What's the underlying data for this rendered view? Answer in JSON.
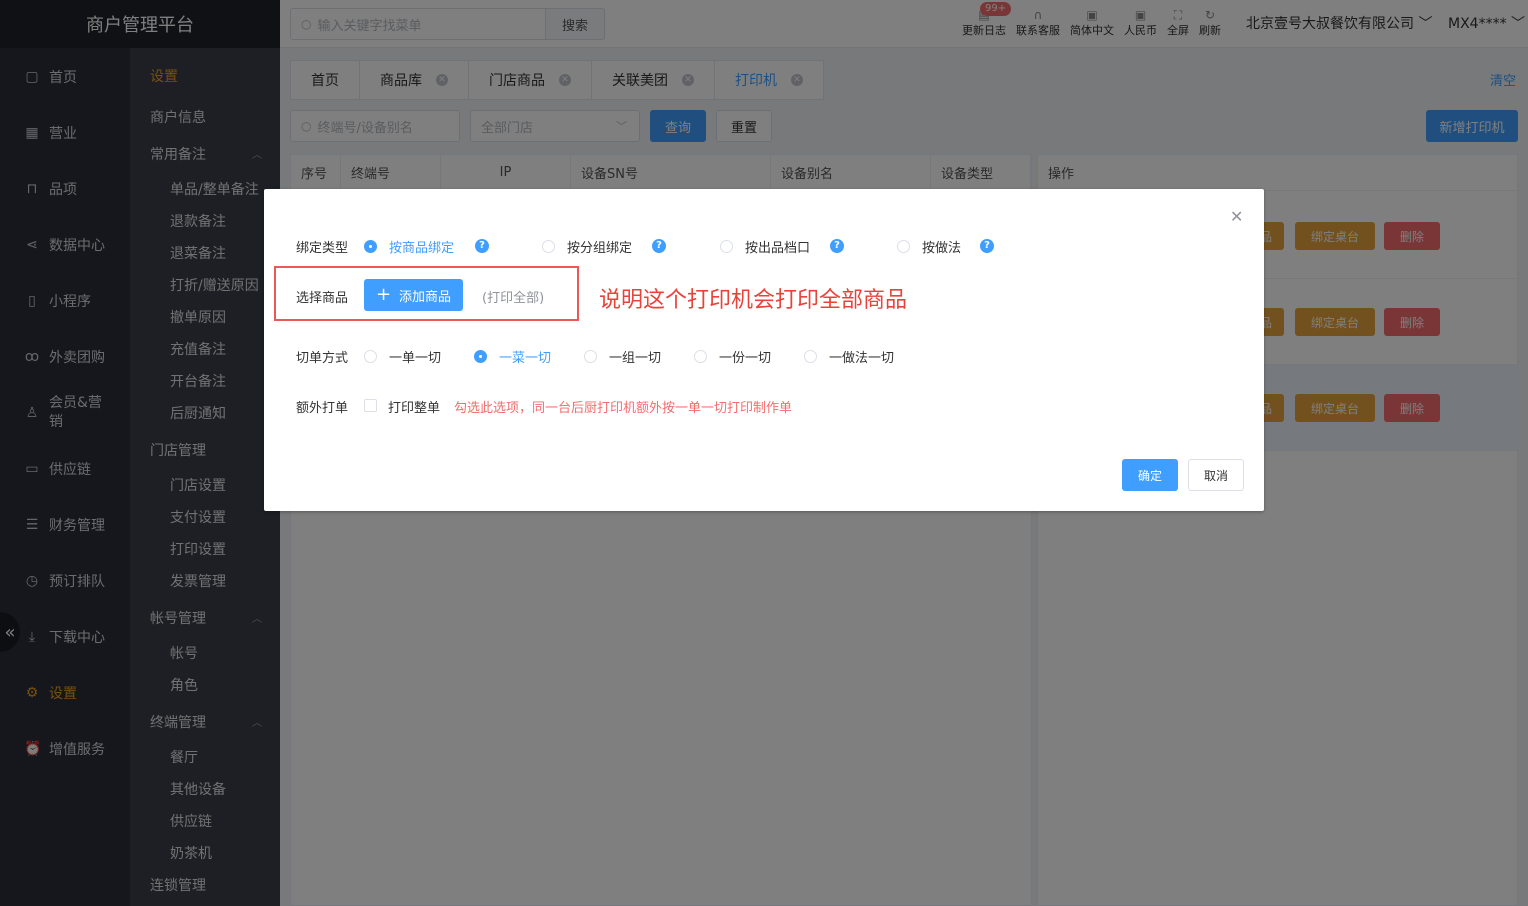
{
  "app": {
    "title": "商户管理平台"
  },
  "sidebar": {
    "items": [
      {
        "label": "首页",
        "icon": "file-icon"
      },
      {
        "label": "营业",
        "icon": "calendar-icon"
      },
      {
        "label": "品项",
        "icon": "bag-icon"
      },
      {
        "label": "数据中心",
        "icon": "share-icon"
      },
      {
        "label": "小程序",
        "icon": "phone-icon"
      },
      {
        "label": "外卖团购",
        "icon": "bike-icon"
      },
      {
        "label": "会员&营销",
        "icon": "user-icon"
      },
      {
        "label": "供应链",
        "icon": "truck-icon"
      },
      {
        "label": "财务管理",
        "icon": "database-icon"
      },
      {
        "label": "预订排队",
        "icon": "clock-icon"
      },
      {
        "label": "下载中心",
        "icon": "download-icon"
      },
      {
        "label": "设置",
        "icon": "gear-icon",
        "active": true
      },
      {
        "label": "增值服务",
        "icon": "alarm-icon"
      }
    ]
  },
  "submenu": {
    "title": "设置",
    "merchant_info": "商户信息",
    "group1": {
      "title": "常用备注",
      "items": [
        "单品/整单备注",
        "退款备注",
        "退菜备注",
        "打折/赠送原因",
        "撤单原因",
        "充值备注",
        "开台备注",
        "后厨通知"
      ]
    },
    "group2": {
      "title": "门店管理",
      "items": [
        "门店设置",
        "支付设置",
        "打印设置",
        "发票管理"
      ]
    },
    "group3": {
      "title": "帐号管理",
      "items": [
        "帐号",
        "角色"
      ]
    },
    "group4": {
      "title": "终端管理",
      "items": [
        "餐厅",
        "其他设备",
        "供应链",
        "奶茶机"
      ]
    },
    "chain": "连锁管理"
  },
  "topbar": {
    "search_placeholder": "输入关键字找菜单",
    "search_button": "搜索",
    "badge": "99+",
    "tools": [
      "更新日志",
      "联系客服",
      "简体中文",
      "人民币",
      "全屏",
      "刷新"
    ],
    "company": "北京壹号大叔餐饮有限公司",
    "user": "MX4****"
  },
  "tabs": [
    "首页",
    "商品库",
    "门店商品",
    "关联美团",
    "打印机"
  ],
  "clear_label": "清空",
  "filters": {
    "terminal_placeholder": "终端号/设备别名",
    "store_placeholder": "全部门店",
    "query": "查询",
    "reset": "重置",
    "new_printer": "新增打印机"
  },
  "table": {
    "columns": [
      "序号",
      "终端号",
      "IP",
      "设备SN号",
      "设备别名",
      "设备类型",
      "操作"
    ],
    "actions": {
      "bind_table": "绑定桌台",
      "delete": "删除",
      "partial": "品"
    }
  },
  "dialog": {
    "bind_type_label": "绑定类型",
    "bind_options": [
      "按商品绑定",
      "按分组绑定",
      "按出品档口",
      "按做法"
    ],
    "bind_selected": 0,
    "select_goods_label": "选择商品",
    "add_goods": "添加商品",
    "print_all": "(打印全部)",
    "annotation": "说明这个打印机会打印全部商品",
    "cut_label": "切单方式",
    "cut_options": [
      "一单一切",
      "一菜一切",
      "一组一切",
      "一份一切",
      "一做法一切"
    ],
    "cut_selected": 1,
    "extra_label": "额外打单",
    "extra_checkbox": "打印整单",
    "extra_hint": "勾选此选项，同一台后厨打印机额外按一单一切打印制作单",
    "ok": "确定",
    "cancel": "取消"
  }
}
